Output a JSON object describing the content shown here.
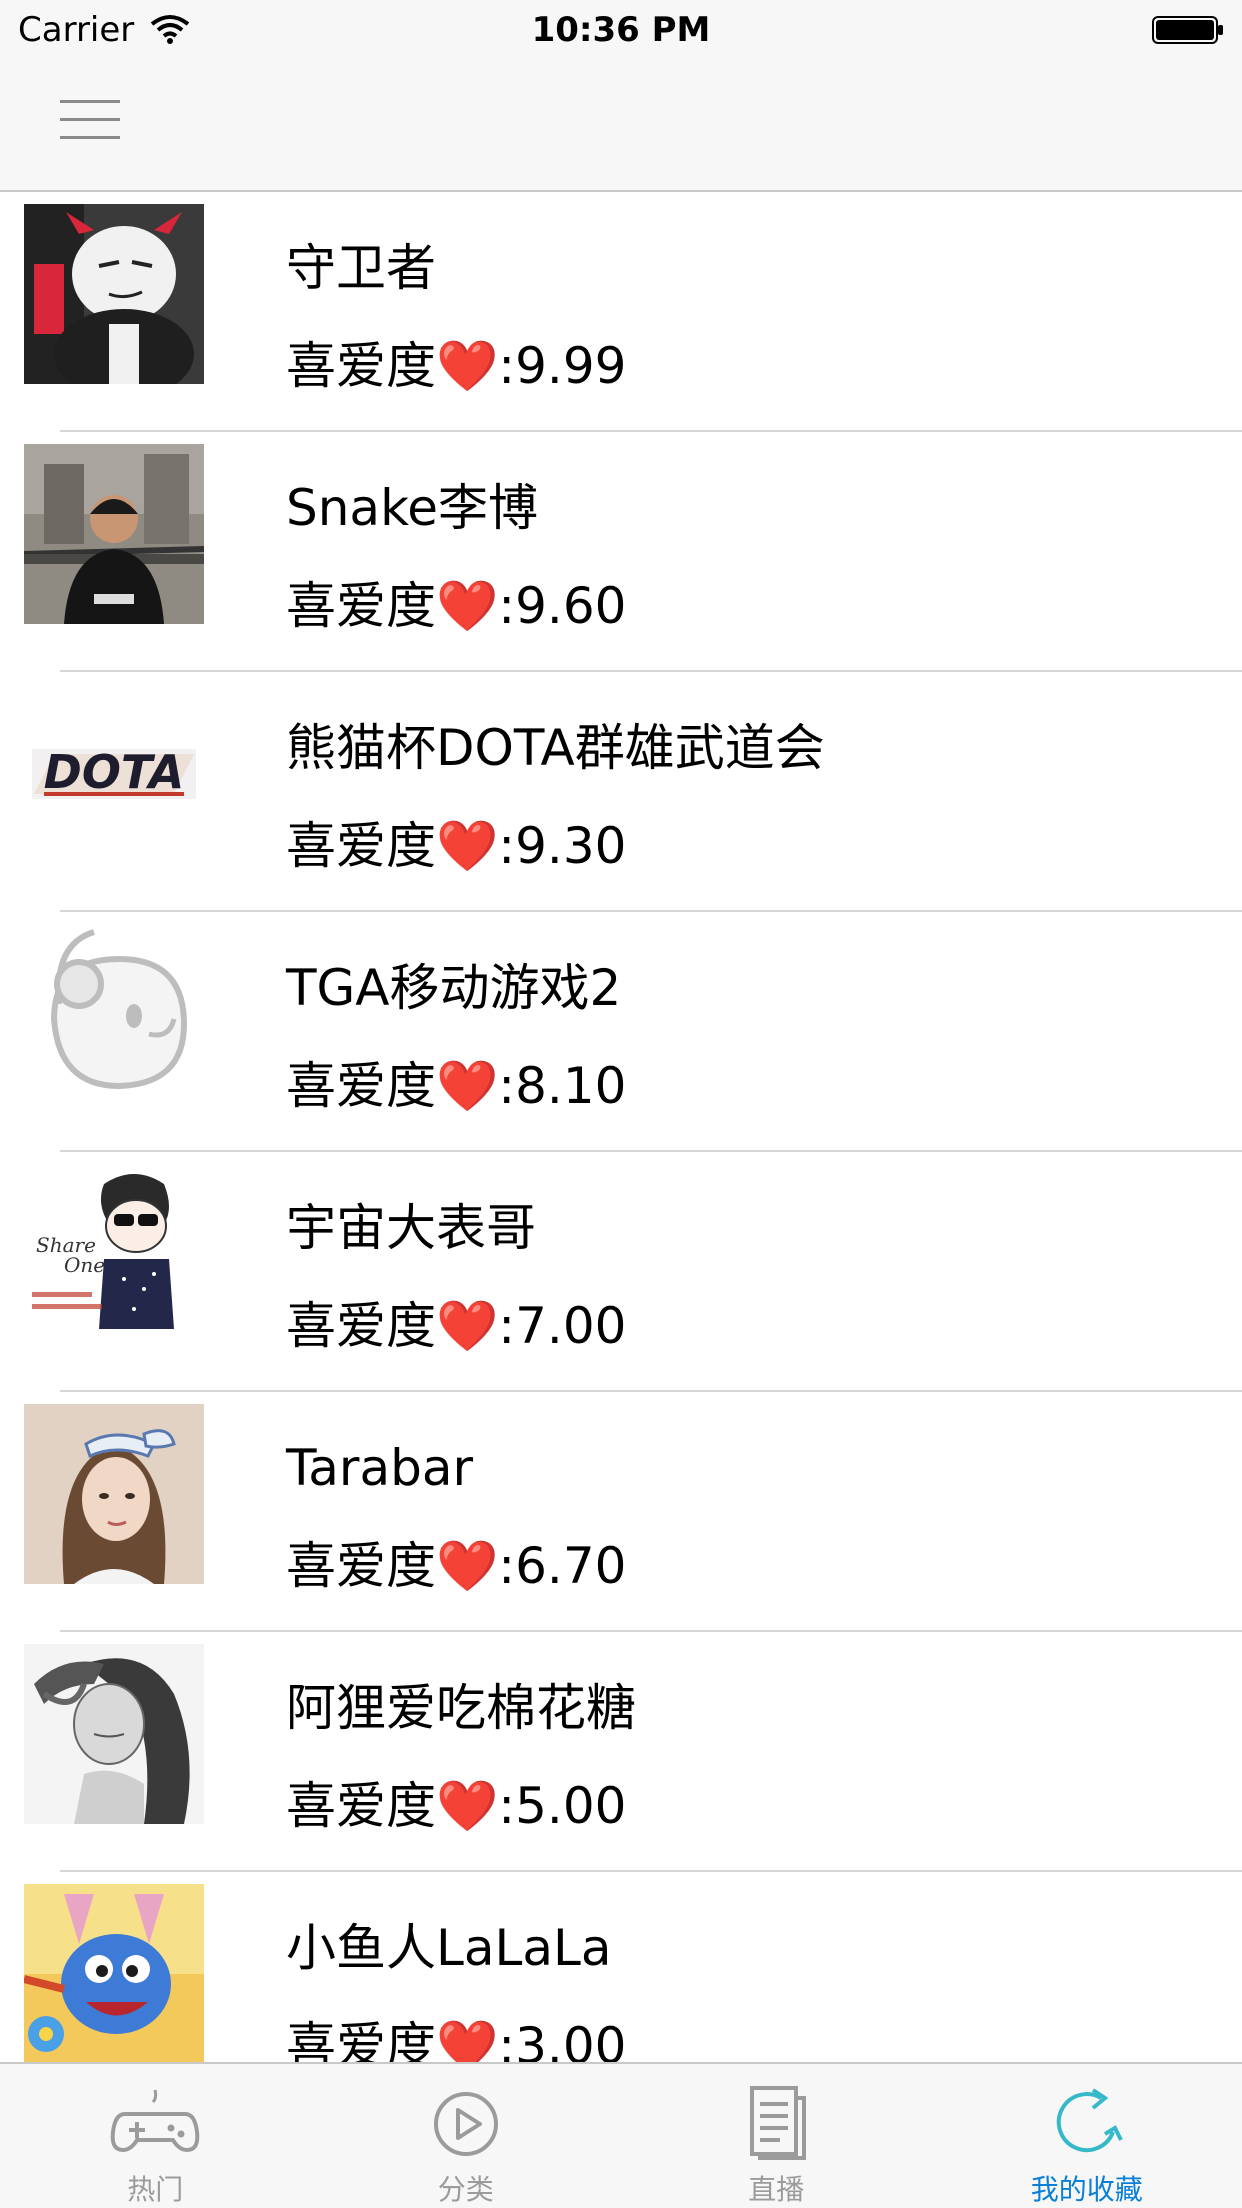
{
  "status_bar": {
    "carrier": "Carrier",
    "time": "10:36 PM"
  },
  "list": {
    "items": [
      {
        "title": "守卫者",
        "rating_label": "喜爱度",
        "heart": "❤️",
        "score": ":9.99"
      },
      {
        "title": "Snake李博",
        "rating_label": "喜爱度",
        "heart": "❤️",
        "score": ":9.60"
      },
      {
        "title": "熊猫杯DOTA群雄武道会",
        "rating_label": "喜爱度",
        "heart": "❤️",
        "score": ":9.30"
      },
      {
        "title": "TGA移动游戏2",
        "rating_label": "喜爱度",
        "heart": "❤️",
        "score": ":8.10"
      },
      {
        "title": "宇宙大表哥",
        "rating_label": "喜爱度",
        "heart": "❤️",
        "score": ":7.00"
      },
      {
        "title": "Tarabar",
        "rating_label": "喜爱度",
        "heart": "❤️",
        "score": ":6.70"
      },
      {
        "title": "阿狸爱吃棉花糖",
        "rating_label": "喜爱度",
        "heart": "❤️",
        "score": ":5.00"
      },
      {
        "title": "小鱼人LaLaLa",
        "rating_label": "喜爱度",
        "heart": "❤️",
        "score": ":3.00"
      }
    ],
    "dota_logo_text": "DOTA"
  },
  "tab_bar": {
    "tabs": [
      {
        "label": "热门",
        "icon": "gamepad-icon"
      },
      {
        "label": "分类",
        "icon": "play-circle-icon"
      },
      {
        "label": "直播",
        "icon": "document-icon"
      },
      {
        "label": "我的收藏",
        "icon": "refresh-icon"
      }
    ],
    "active_index": 3
  },
  "colors": {
    "accent": "#0a7fd8",
    "heart": "#e21b22",
    "icon_teal": "#35b9c9",
    "tab_inactive": "#9b9b9b"
  }
}
